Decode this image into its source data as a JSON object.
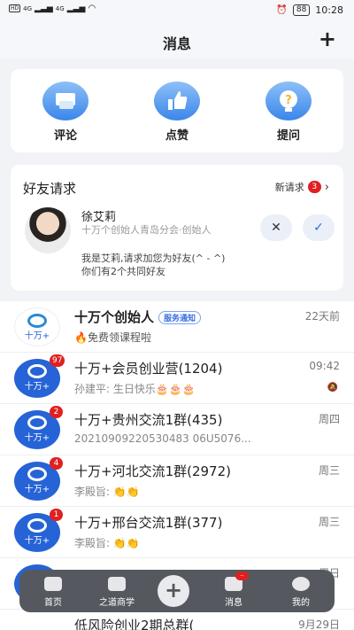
{
  "status_bar": {
    "hd1": "HD",
    "hd2": "HD",
    "net1": "4G",
    "net2": "4G",
    "battery": "88",
    "time": "10:28"
  },
  "header": {
    "title": "消息",
    "add_symbol": "+"
  },
  "quick_actions": [
    {
      "label": "评论",
      "icon": "comment-icon"
    },
    {
      "label": "点赞",
      "icon": "thumbs-up-icon"
    },
    {
      "label": "提问",
      "icon": "question-icon"
    }
  ],
  "friend_request": {
    "title": "好友请求",
    "new_label": "新请求",
    "new_count": "3",
    "name": "徐艾莉",
    "org": "十万个创始人青岛分会·创始人",
    "message": "我是艾莉,请求加您为好友(^ - ^)",
    "common": "你们有2个共同好友",
    "reject": "✕",
    "accept": "✓"
  },
  "conversations": [
    {
      "name": "十万个创始人",
      "tag": "服务通知",
      "sub": "🔥免费领课程啦",
      "time": "22天前",
      "badge": ""
    },
    {
      "name": "十万+会员创业营(1204)",
      "sub": "孙建平: 生日快乐🎂🎂🎂",
      "time": "09:42",
      "badge": "97"
    },
    {
      "name": "十万+贵州交流1群(435)",
      "sub": "20210909220530483 06U5076...",
      "time": "周四",
      "badge": "2"
    },
    {
      "name": "十万+河北交流1群(2972)",
      "sub": "李殿旨: 👏👏",
      "time": "周三",
      "badge": "4"
    },
    {
      "name": "十万+邢台交流1群(377)",
      "sub": "李殿旨: 👏👏",
      "time": "周三",
      "badge": "1"
    },
    {
      "name": "",
      "sub": "",
      "time": "周日",
      "badge": ""
    },
    {
      "name": "低风险创业2期总群(",
      "sub": "",
      "time": "9月29日",
      "badge": ""
    }
  ],
  "avatar_text": "十万+",
  "tabbar": [
    {
      "label": "首页"
    },
    {
      "label": "之道商学"
    },
    {
      "label": "+"
    },
    {
      "label": "消息",
      "badge": "··"
    },
    {
      "label": "我的"
    }
  ]
}
